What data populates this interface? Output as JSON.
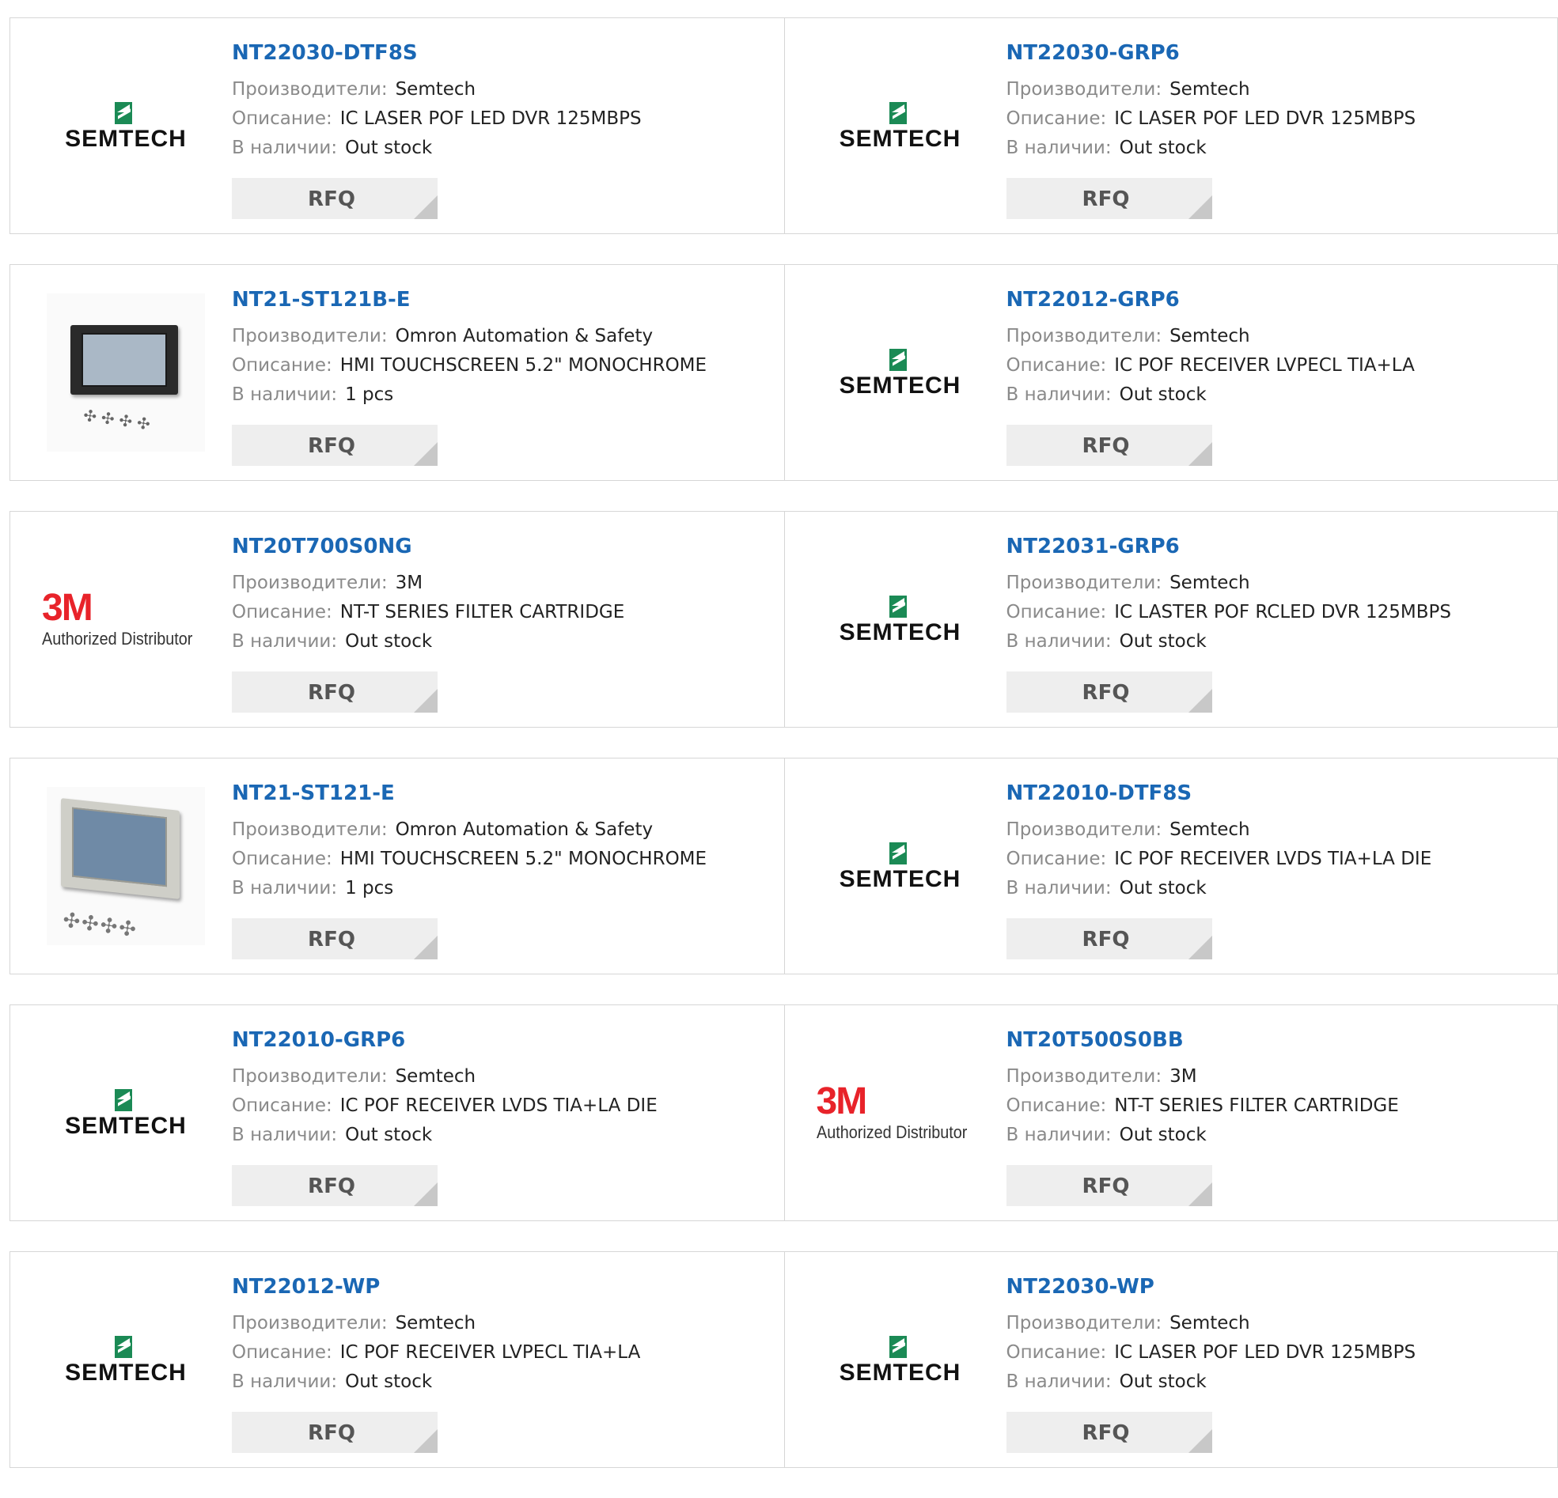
{
  "labels": {
    "manufacturer": "Производители:",
    "description": "Описание:",
    "stock": "В наличии:",
    "rfq": "RFQ"
  },
  "colors": {
    "link": "#1a67b4",
    "label": "#8a8a8a",
    "border": "#d6d6d6",
    "button_bg": "#eeeeee",
    "semtech_green": "#1b8a55",
    "three_m_red": "#e8232a"
  },
  "logos": {
    "semtech_word": "SEMTECH",
    "three_m_big": "3M",
    "three_m_sub": "Authorized Distributor"
  },
  "products": [
    {
      "pn": "NT22030-DTF8S",
      "manufacturer": "Semtech",
      "description": "IC LASER POF LED DVR 125MBPS",
      "stock": "Out stock",
      "image": "semtech-logo"
    },
    {
      "pn": "NT22030-GRP6",
      "manufacturer": "Semtech",
      "description": "IC LASER POF LED DVR 125MBPS",
      "stock": "Out stock",
      "image": "semtech-logo"
    },
    {
      "pn": "NT21-ST121B-E",
      "manufacturer": "Omron Automation & Safety",
      "description": "HMI TOUCHSCREEN 5.2\" MONOCHROME",
      "stock": "1 pcs",
      "image": "touchscreen-dark"
    },
    {
      "pn": "NT22012-GRP6",
      "manufacturer": "Semtech",
      "description": "IC POF RECEIVER LVPECL TIA+LA",
      "stock": "Out stock",
      "image": "semtech-logo"
    },
    {
      "pn": "NT20T700S0NG",
      "manufacturer": "3M",
      "description": "NT-T SERIES FILTER CARTRIDGE",
      "stock": "Out stock",
      "image": "3m-logo"
    },
    {
      "pn": "NT22031-GRP6",
      "manufacturer": "Semtech",
      "description": "IC LASTER POF RCLED DVR 125MBPS",
      "stock": "Out stock",
      "image": "semtech-logo"
    },
    {
      "pn": "NT21-ST121-E",
      "manufacturer": "Omron Automation & Safety",
      "description": "HMI TOUCHSCREEN 5.2\" MONOCHROME",
      "stock": "1 pcs",
      "image": "touchscreen-light"
    },
    {
      "pn": "NT22010-DTF8S",
      "manufacturer": "Semtech",
      "description": "IC POF RECEIVER LVDS TIA+LA DIE",
      "stock": "Out stock",
      "image": "semtech-logo"
    },
    {
      "pn": "NT22010-GRP6",
      "manufacturer": "Semtech",
      "description": "IC POF RECEIVER LVDS TIA+LA DIE",
      "stock": "Out stock",
      "image": "semtech-logo"
    },
    {
      "pn": "NT20T500S0BB",
      "manufacturer": "3M",
      "description": "NT-T SERIES FILTER CARTRIDGE",
      "stock": "Out stock",
      "image": "3m-logo"
    },
    {
      "pn": "NT22012-WP",
      "manufacturer": "Semtech",
      "description": "IC POF RECEIVER LVPECL TIA+LA",
      "stock": "Out stock",
      "image": "semtech-logo"
    },
    {
      "pn": "NT22030-WP",
      "manufacturer": "Semtech",
      "description": "IC LASER POF LED DVR 125MBPS",
      "stock": "Out stock",
      "image": "semtech-logo"
    }
  ]
}
